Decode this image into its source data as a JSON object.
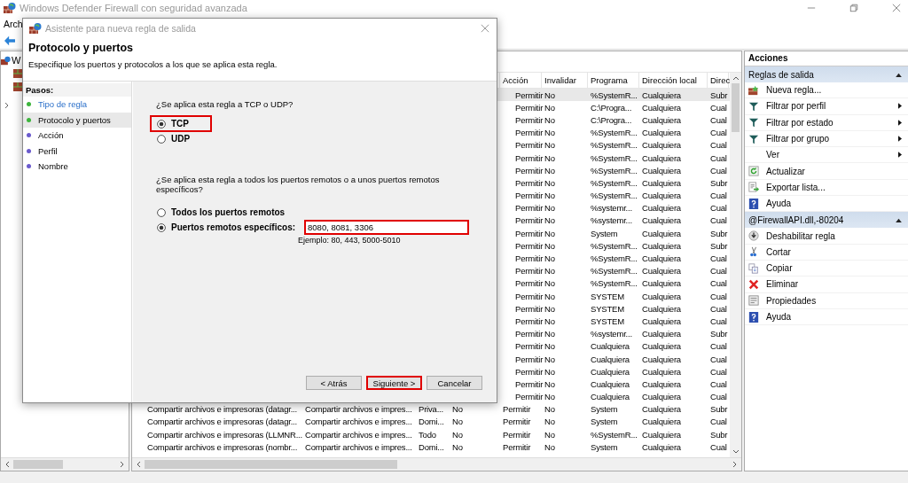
{
  "window": {
    "title": "Windows Defender Firewall con seguridad avanzada"
  },
  "menu": [
    "Arch"
  ],
  "tree": {
    "root": "W"
  },
  "table": {
    "columns": [
      "Acción",
      "Invalidar",
      "Programa",
      "Dirección local",
      "Direc"
    ],
    "rows": [
      {
        "selected": true,
        "cells": [
          "Permitir",
          "No",
          "%SystemR...",
          "Cualquiera",
          "Subr"
        ]
      },
      {
        "selected": false,
        "cells": [
          "Permitir",
          "No",
          "C:\\Progra...",
          "Cualquiera",
          "Cual"
        ]
      },
      {
        "selected": false,
        "cells": [
          "Permitir",
          "No",
          "C:\\Progra...",
          "Cualquiera",
          "Cual"
        ]
      },
      {
        "selected": false,
        "cells": [
          "Permitir",
          "No",
          "%SystemR...",
          "Cualquiera",
          "Cual"
        ]
      },
      {
        "selected": false,
        "cells": [
          "Permitir",
          "No",
          "%SystemR...",
          "Cualquiera",
          "Cual"
        ]
      },
      {
        "selected": false,
        "cells": [
          "Permitir",
          "No",
          "%SystemR...",
          "Cualquiera",
          "Cual"
        ]
      },
      {
        "selected": false,
        "cells": [
          "Permitir",
          "No",
          "%SystemR...",
          "Cualquiera",
          "Cual"
        ]
      },
      {
        "selected": false,
        "cells": [
          "Permitir",
          "No",
          "%SystemR...",
          "Cualquiera",
          "Subr"
        ]
      },
      {
        "selected": false,
        "cells": [
          "Permitir",
          "No",
          "%SystemR...",
          "Cualquiera",
          "Cual"
        ]
      },
      {
        "selected": false,
        "cells": [
          "Permitir",
          "No",
          "%systemr...",
          "Cualquiera",
          "Cual"
        ]
      },
      {
        "selected": false,
        "cells": [
          "Permitir",
          "No",
          "%systemr...",
          "Cualquiera",
          "Cual"
        ]
      },
      {
        "selected": false,
        "cells": [
          "Permitir",
          "No",
          "System",
          "Cualquiera",
          "Subr"
        ]
      },
      {
        "selected": false,
        "cells": [
          "Permitir",
          "No",
          "%SystemR...",
          "Cualquiera",
          "Subr"
        ]
      },
      {
        "selected": false,
        "cells": [
          "Permitir",
          "No",
          "%SystemR...",
          "Cualquiera",
          "Cual"
        ]
      },
      {
        "selected": false,
        "cells": [
          "Permitir",
          "No",
          "%SystemR...",
          "Cualquiera",
          "Cual"
        ]
      },
      {
        "selected": false,
        "cells": [
          "Permitir",
          "No",
          "%SystemR...",
          "Cualquiera",
          "Cual"
        ]
      },
      {
        "selected": false,
        "cells": [
          "Permitir",
          "No",
          "SYSTEM",
          "Cualquiera",
          "Cual"
        ]
      },
      {
        "selected": false,
        "cells": [
          "Permitir",
          "No",
          "SYSTEM",
          "Cualquiera",
          "Cual"
        ]
      },
      {
        "selected": false,
        "cells": [
          "Permitir",
          "No",
          "SYSTEM",
          "Cualquiera",
          "Cual"
        ]
      },
      {
        "selected": false,
        "cells": [
          "Permitir",
          "No",
          "%systemr...",
          "Cualquiera",
          "Subr"
        ]
      },
      {
        "selected": false,
        "cells": [
          "Permitir",
          "No",
          "Cualquiera",
          "Cualquiera",
          "Cual"
        ]
      },
      {
        "selected": false,
        "cells": [
          "Permitir",
          "No",
          "Cualquiera",
          "Cualquiera",
          "Cual"
        ]
      },
      {
        "selected": false,
        "cells": [
          "Permitir",
          "No",
          "Cualquiera",
          "Cualquiera",
          "Cual"
        ]
      },
      {
        "selected": false,
        "cells": [
          "Permitir",
          "No",
          "Cualquiera",
          "Cualquiera",
          "Cual"
        ]
      },
      {
        "selected": false,
        "cells": [
          "Permitir",
          "No",
          "Cualquiera",
          "Cualquiera",
          "Cual"
        ]
      },
      {
        "selected": false,
        "cells": [
          "Compartir archivos e impresoras (datagr...",
          "Compartir archivos e impres...",
          "Priva...",
          "No",
          "Permitir",
          "No",
          "System",
          "Cualquiera",
          "Subr"
        ]
      },
      {
        "selected": false,
        "cells": [
          "Compartir archivos e impresoras (datagr...",
          "Compartir archivos e impres...",
          "Domi...",
          "No",
          "Permitir",
          "No",
          "System",
          "Cualquiera",
          "Cual"
        ]
      },
      {
        "selected": false,
        "cells": [
          "Compartir archivos e impresoras (LLMNR...",
          "Compartir archivos e impres...",
          "Todo",
          "No",
          "Permitir",
          "No",
          "%SystemR...",
          "Cualquiera",
          "Subr"
        ]
      },
      {
        "selected": false,
        "cells": [
          "Compartir archivos e impresoras (nombr...",
          "Compartir archivos e impres...",
          "Domi...",
          "No",
          "Permitir",
          "No",
          "System",
          "Cualquiera",
          "Cual"
        ]
      }
    ]
  },
  "actions": {
    "title": "Acciones",
    "sections": [
      {
        "title": "Reglas de salida",
        "expanded": true,
        "items": [
          {
            "label": "Nueva regla...",
            "kind": "new",
            "submenu": false
          },
          {
            "label": "Filtrar por perfil",
            "kind": "filter",
            "submenu": true
          },
          {
            "label": "Filtrar por estado",
            "kind": "filter",
            "submenu": true
          },
          {
            "label": "Filtrar por grupo",
            "kind": "filter",
            "submenu": true
          },
          {
            "label": "Ver",
            "kind": "none",
            "submenu": true
          },
          {
            "label": "Actualizar",
            "kind": "refresh",
            "submenu": false
          },
          {
            "label": "Exportar lista...",
            "kind": "export",
            "submenu": false
          },
          {
            "label": "Ayuda",
            "kind": "help",
            "submenu": false
          }
        ]
      },
      {
        "title": "@FirewallAPI.dll,-80204",
        "expanded": true,
        "items": [
          {
            "label": "Deshabilitar regla",
            "kind": "disable",
            "submenu": false
          },
          {
            "label": "Cortar",
            "kind": "cut",
            "submenu": false
          },
          {
            "label": "Copiar",
            "kind": "copy",
            "submenu": false
          },
          {
            "label": "Eliminar",
            "kind": "delete",
            "submenu": false
          },
          {
            "label": "Propiedades",
            "kind": "properties",
            "submenu": false
          },
          {
            "label": "Ayuda",
            "kind": "help",
            "submenu": false
          }
        ]
      }
    ]
  },
  "dialog": {
    "title": "Asistente para nueva regla de salida",
    "heading": "Protocolo y puertos",
    "description": "Especifique los puertos y protocolos a los que se aplica esta regla.",
    "steps_title": "Pasos:",
    "steps": [
      {
        "label": "Tipo de regla",
        "completed": true,
        "selected": false,
        "color": "#3cb43c"
      },
      {
        "label": "Protocolo y puertos",
        "completed": false,
        "selected": true,
        "color": "#3cb43c"
      },
      {
        "label": "Acción",
        "completed": false,
        "selected": false,
        "color": "#6a5acd"
      },
      {
        "label": "Perfil",
        "completed": false,
        "selected": false,
        "color": "#6a5acd"
      },
      {
        "label": "Nombre",
        "completed": false,
        "selected": false,
        "color": "#6a5acd"
      }
    ],
    "protocol_question": "¿Se aplica esta regla a TCP o UDP?",
    "protocols": [
      {
        "label": "TCP",
        "selected": true,
        "highlighted": true
      },
      {
        "label": "UDP",
        "selected": false,
        "highlighted": false
      }
    ],
    "ports_question": "¿Se aplica esta regla a todos los puertos remotos o a unos puertos remotos específicos?",
    "port_options": [
      {
        "label": "Todos los puertos remotos",
        "selected": false
      },
      {
        "label": "Puertos remotos específicos:",
        "selected": true
      }
    ],
    "ports_field": {
      "value": "8080, 8081, 3306",
      "highlighted": true
    },
    "example": "Ejemplo: 80, 443, 5000-5010",
    "buttons": [
      {
        "label": "< Atrás",
        "highlighted": false
      },
      {
        "label": "Siguiente >",
        "highlighted": true
      },
      {
        "label": "Cancelar",
        "highlighted": false
      }
    ]
  }
}
